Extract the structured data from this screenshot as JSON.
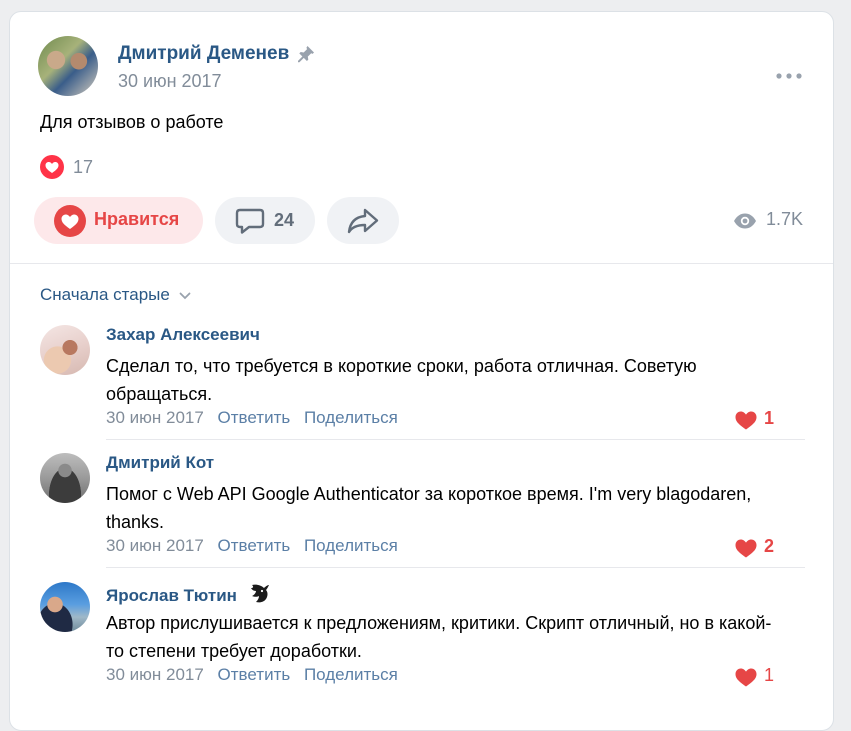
{
  "post": {
    "author": "Дмитрий Деменев",
    "date": "30 июн 2017",
    "text": "Для отзывов о работе",
    "likes_count": "17",
    "like_label": "Нравится",
    "comments_count": "24",
    "views": "1.7K"
  },
  "comments_section": {
    "sort_label": "Сначала старые"
  },
  "comments": [
    {
      "name": "Захар Алексеевич",
      "text": "Сделал то, что требуется в короткие сроки, работа отличная. Советую обращаться.",
      "date": "30 июн 2017",
      "reply": "Ответить",
      "share": "Поделиться",
      "likes": "1"
    },
    {
      "name": "Дмитрий Кот",
      "text": "Помог с Web API Google Authenticator за короткое время. I'm very blagodaren, thanks.",
      "date": "30 июн 2017",
      "reply": "Ответить",
      "share": "Поделиться",
      "likes": "2"
    },
    {
      "name": "Ярослав Тютин",
      "text": "Автор прислушивается к предложениям, критики. Скрипт отличный, но в какой-то степени требует доработки.",
      "date": "30 июн 2017",
      "reply": "Ответить",
      "share": "Поделиться",
      "likes": "1"
    }
  ],
  "colors": {
    "link": "#2a5885",
    "secondary": "#818c99",
    "like_red": "#e64646"
  }
}
